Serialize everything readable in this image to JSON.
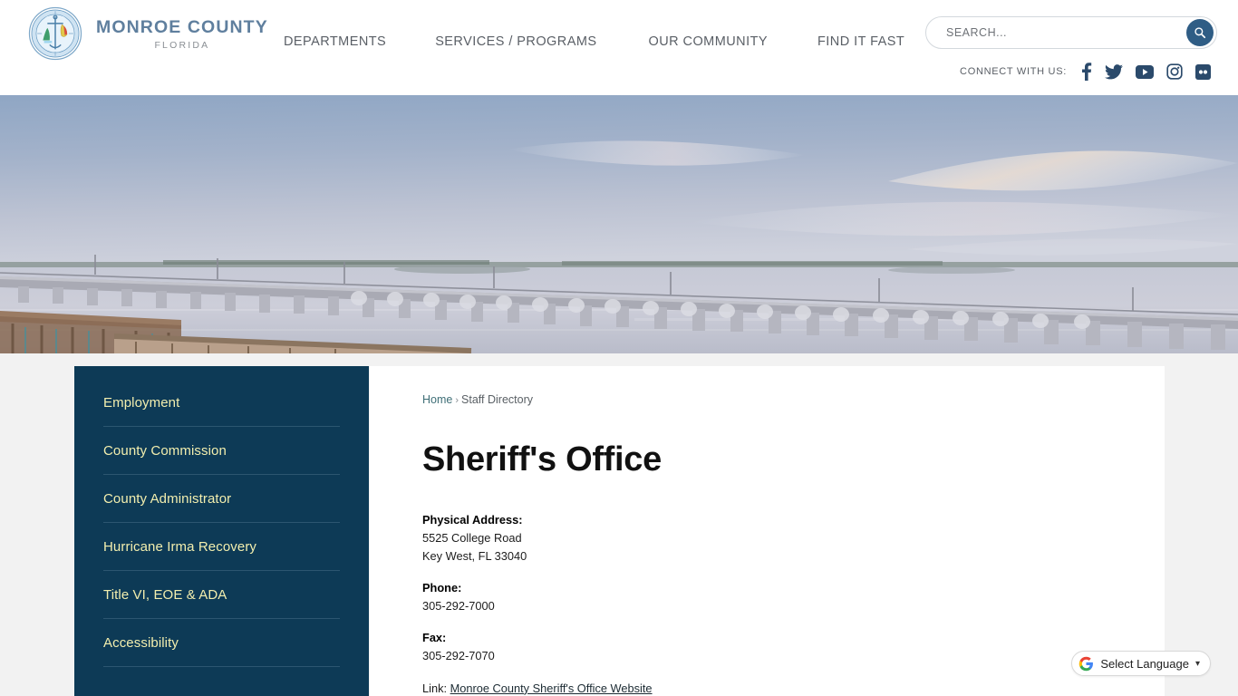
{
  "header": {
    "brand": {
      "title": "MONROE COUNTY",
      "subtitle": "FLORIDA",
      "seal_alt": "county-seal"
    },
    "nav": [
      {
        "label": "DEPARTMENTS"
      },
      {
        "label": "SERVICES / PROGRAMS"
      },
      {
        "label": "OUR COMMUNITY"
      },
      {
        "label": "FIND IT FAST"
      }
    ],
    "search": {
      "placeholder": "SEARCH...",
      "value": "",
      "button_icon": "search-icon"
    },
    "connect": {
      "label": "CONNECT WITH US:",
      "social": [
        {
          "name": "facebook-icon"
        },
        {
          "name": "twitter-icon"
        },
        {
          "name": "youtube-icon"
        },
        {
          "name": "instagram-icon"
        },
        {
          "name": "flickr-icon"
        }
      ]
    }
  },
  "hero": {
    "alt": "bridge-over-water-at-dusk"
  },
  "sidebar": {
    "items": [
      {
        "label": "Employment"
      },
      {
        "label": "County Commission"
      },
      {
        "label": "County Administrator"
      },
      {
        "label": "Hurricane Irma Recovery"
      },
      {
        "label": "Title VI, EOE & ADA"
      },
      {
        "label": "Accessibility"
      }
    ]
  },
  "main": {
    "breadcrumb": {
      "home": "Home",
      "separator": "›",
      "current": "Staff Directory"
    },
    "title": "Sheriff's Office",
    "contact": {
      "address_label": "Physical Address:",
      "address_line1": "5525 College Road",
      "address_line2": "Key West, FL 33040",
      "phone_label": "Phone:",
      "phone_value": "305-292-7000",
      "fax_label": "Fax:",
      "fax_value": "305-292-7070",
      "link_label": "Link:",
      "link_text": "Monroe County Sheriff's Office Website"
    }
  },
  "translate": {
    "label": "Select Language",
    "caret": "⌄",
    "icon": "google-g-icon"
  },
  "colors": {
    "sidebar_bg": "#0d3a56",
    "sidebar_text": "#f2eeae",
    "page_bg": "#f2f2f2",
    "brand_blue": "#5f7f9e",
    "social_navy": "#2b4a6b",
    "search_btn": "#2f5d85"
  }
}
